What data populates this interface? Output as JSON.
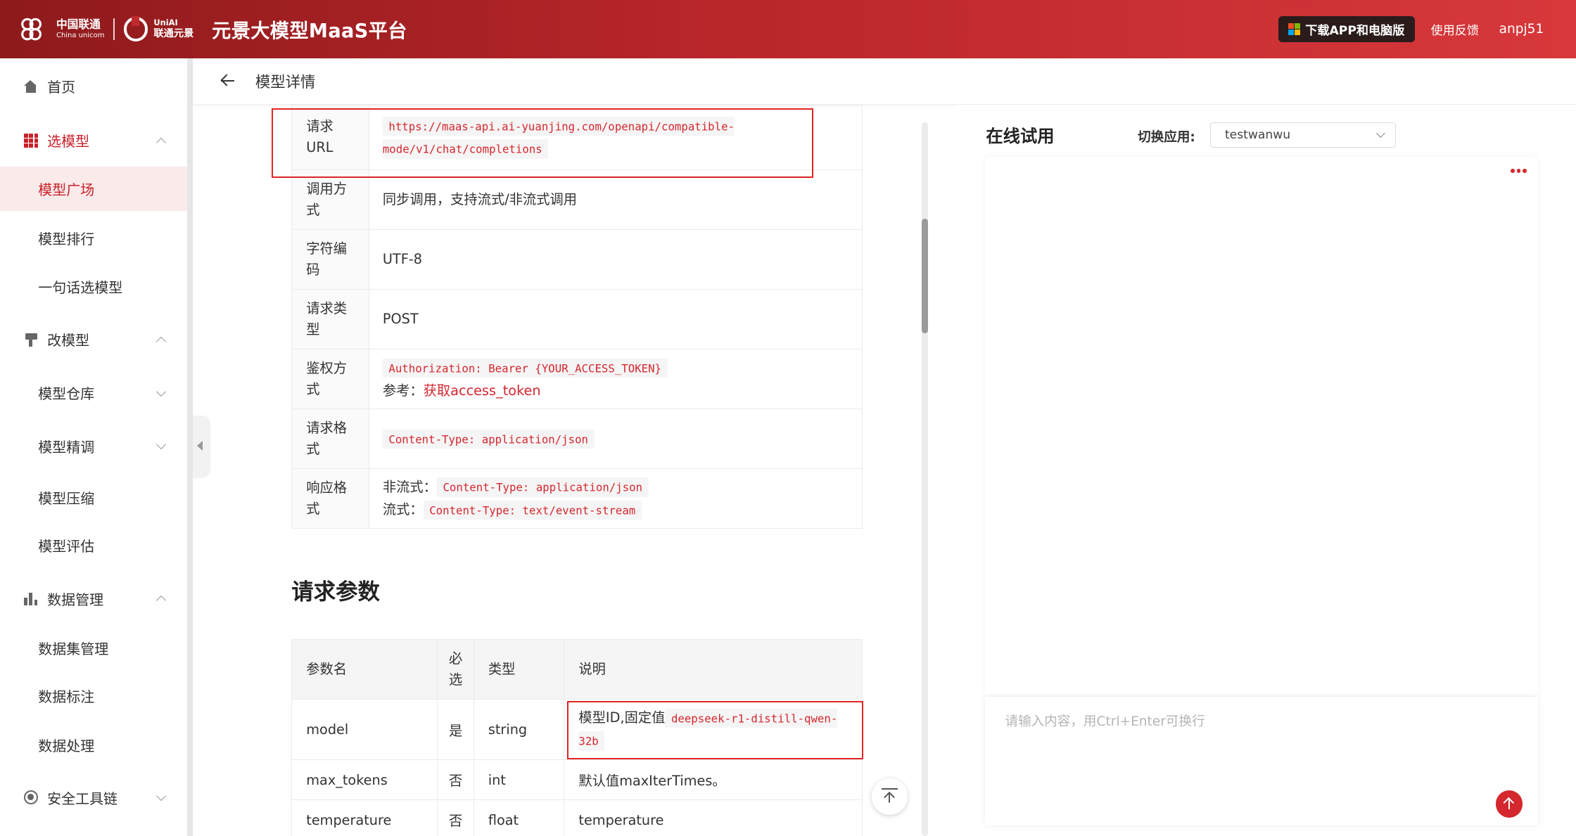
{
  "header": {
    "cu_logo_cn": "中国联通",
    "cu_logo_en": "China unicom",
    "uni_logo_en": "UniAI",
    "uni_logo_cn": "联通元景",
    "platform_title": "元景大模型MaaS平台",
    "download_label": "下载APP和电脑版",
    "feedback_label": "使用反馈",
    "username": "anpj51"
  },
  "sidebar": {
    "items": [
      {
        "label": "首页"
      },
      {
        "label": "选模型"
      },
      {
        "label": "模型广场"
      },
      {
        "label": "模型排行"
      },
      {
        "label": "一句话选模型"
      },
      {
        "label": "改模型"
      },
      {
        "label": "模型仓库"
      },
      {
        "label": "模型精调"
      },
      {
        "label": "模型压缩"
      },
      {
        "label": "模型评估"
      },
      {
        "label": "数据管理"
      },
      {
        "label": "数据集管理"
      },
      {
        "label": "数据标注"
      },
      {
        "label": "数据处理"
      },
      {
        "label": "安全工具链"
      }
    ]
  },
  "page": {
    "title": "模型详情"
  },
  "info_table": {
    "rows": [
      {
        "key": "请求URL",
        "value": "https://maas-api.ai-yuanjing.com/openapi/compatible-mode/v1/chat/completions"
      },
      {
        "key": "调用方式",
        "value": "同步调用，支持流式/非流式调用"
      },
      {
        "key": "字符编码",
        "value": "UTF-8"
      },
      {
        "key": "请求类型",
        "value": "POST"
      },
      {
        "key": "鉴权方式",
        "value": "Authorization: Bearer {YOUR_ACCESS_TOKEN}",
        "ref_label": "参考：",
        "ref_link": "获取access_token"
      },
      {
        "key": "请求格式",
        "value": "Content-Type: application/json"
      },
      {
        "key": "响应格式",
        "non_stream_label": "非流式：",
        "non_stream_value": "Content-Type: application/json",
        "stream_label": "流式：",
        "stream_value": "Content-Type: text/event-stream"
      }
    ]
  },
  "params": {
    "section_title": "请求参数",
    "headers": [
      "参数名",
      "必选",
      "类型",
      "说明"
    ],
    "rows": [
      {
        "name": "model",
        "required": "是",
        "type": "string",
        "desc": "模型ID,固定值",
        "code": "deepseek-r1-distill-qwen-32b"
      },
      {
        "name": "max_tokens",
        "required": "否",
        "type": "int",
        "desc": "默认值maxIterTimes。"
      },
      {
        "name": "temperature",
        "required": "否",
        "type": "float",
        "desc": "temperature"
      }
    ]
  },
  "try_panel": {
    "title": "在线试用",
    "switch_label": "切换应用:",
    "selected_app": "testwanwu",
    "input_placeholder": "请输入内容，用Ctrl+Enter可换行"
  },
  "colors": {
    "brand_red": "#c8222b",
    "header_gradient_start": "#8e1a1c",
    "header_gradient_end": "#d8383b",
    "highlight_box": "#e02424"
  }
}
